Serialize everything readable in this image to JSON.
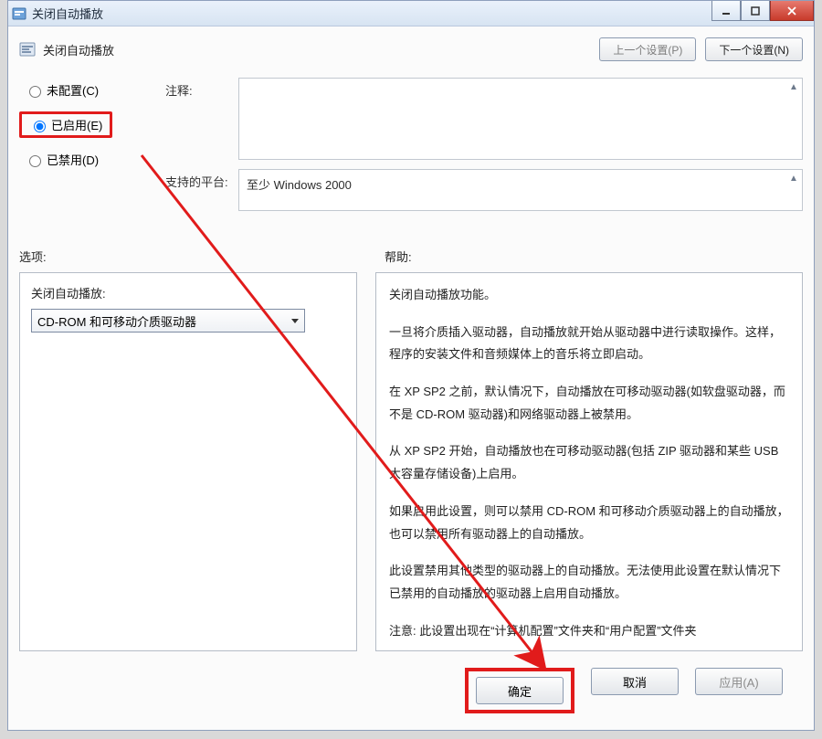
{
  "titlebar": {
    "title": "关闭自动播放"
  },
  "header": {
    "title": "关闭自动播放",
    "prev_btn": "上一个设置(P)",
    "next_btn": "下一个设置(N)"
  },
  "radios": {
    "not_configured": "未配置(C)",
    "enabled": "已启用(E)",
    "disabled": "已禁用(D)"
  },
  "meta": {
    "comment_label": "注释:",
    "platform_label": "支持的平台:",
    "platform_value": "至少 Windows 2000"
  },
  "columns": {
    "options_label": "选项:",
    "help_label": "帮助:"
  },
  "options": {
    "field_label": "关闭自动播放:",
    "selected": "CD-ROM 和可移动介质驱动器"
  },
  "help": {
    "p1": "关闭自动播放功能。",
    "p2": "一旦将介质插入驱动器，自动播放就开始从驱动器中进行读取操作。这样，程序的安装文件和音频媒体上的音乐将立即启动。",
    "p3": "在 XP SP2 之前，默认情况下，自动播放在可移动驱动器(如软盘驱动器，而不是 CD-ROM 驱动器)和网络驱动器上被禁用。",
    "p4": "从 XP SP2 开始，自动播放也在可移动驱动器(包括 ZIP 驱动器和某些 USB 大容量存储设备)上启用。",
    "p5": "如果启用此设置，则可以禁用 CD-ROM 和可移动介质驱动器上的自动播放，也可以禁用所有驱动器上的自动播放。",
    "p6": "此设置禁用其他类型的驱动器上的自动播放。无法使用此设置在默认情况下已禁用的自动播放的驱动器上启用自动播放。",
    "p7": "注意: 此设置出现在“计算机配置”文件夹和“用户配置”文件夹"
  },
  "footer": {
    "ok": "确定",
    "cancel": "取消",
    "apply": "应用(A)"
  }
}
